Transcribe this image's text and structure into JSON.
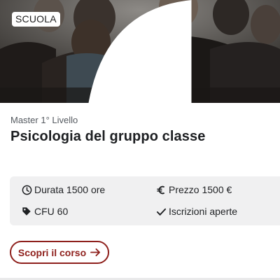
{
  "card": {
    "category_badge": "SCUOLA",
    "level": "Master 1° Livello",
    "title": "Psicologia del gruppo classe",
    "details": {
      "duration": "Durata 1500 ore",
      "price": "Prezzo 1500 €",
      "credits": "CFU 60",
      "enrollment": "Iscrizioni aperte"
    },
    "cta_label": "Scopri il corso"
  },
  "icons": {
    "duration": "clock-icon",
    "price": "euro-icon",
    "credits": "tag-icon",
    "enrollment": "check-icon",
    "cta": "arrow-right-icon"
  },
  "colors": {
    "accent": "#8e1f1b",
    "info_background": "#f0f0f1",
    "title_text": "#1d1f22"
  }
}
